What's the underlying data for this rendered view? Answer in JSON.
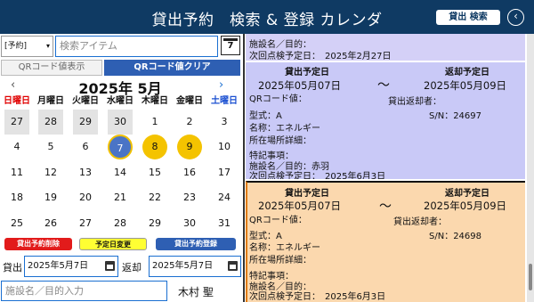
{
  "header": {
    "title": "貸出予約　検索 & 登録 カレンダ",
    "search_button": "貸出 検索",
    "back_icon": "‹"
  },
  "filter": {
    "selected": "[予約]",
    "caret": "▾",
    "search_placeholder": "検索アイテム",
    "calendar_icon_day": "7"
  },
  "qr": {
    "show_label": "QRコード値表示",
    "clear_label": "QRコード値クリア"
  },
  "calendar": {
    "month_title": "2025年 5月",
    "prev": "‹",
    "next": "›",
    "weekdays": [
      "日曜日",
      "月曜日",
      "火曜日",
      "水曜日",
      "木曜日",
      "金曜日",
      "土曜日"
    ],
    "weeks": [
      [
        "27",
        "28",
        "29",
        "30",
        "1",
        "2",
        "3"
      ],
      [
        "4",
        "5",
        "6",
        "7",
        "8",
        "9",
        "10"
      ],
      [
        "11",
        "12",
        "13",
        "14",
        "15",
        "16",
        "17"
      ],
      [
        "18",
        "19",
        "20",
        "21",
        "22",
        "23",
        "24"
      ],
      [
        "25",
        "26",
        "27",
        "28",
        "29",
        "30",
        "31"
      ]
    ],
    "selected_day": "7",
    "highlighted_days": [
      "8",
      "9"
    ]
  },
  "actions": {
    "delete": "貸出予約削除",
    "change": "予定日変更",
    "register": "貸出予約登録"
  },
  "form": {
    "lend_label": "貸出",
    "lend_date": "2025年5月7日",
    "return_label": "返却",
    "return_date": "2025年5月7日",
    "purpose_placeholder": "施設名／目的入力",
    "user": "木村 聖"
  },
  "cards": [
    {
      "facility": "施設名／目的：",
      "next_check": "次回点検予定日：　2025年2月27日"
    },
    {
      "lend_header": "貸出予定日",
      "return_header": "返却予定日",
      "lend_date": "2025年05月07日",
      "tilde": "〜",
      "return_date": "2025年05月09日",
      "qr": "QRコード値：",
      "returner": "貸出返却者：",
      "model": "型式：A",
      "sn": "S/N：24697",
      "name": "名称：エネルギー",
      "location": "所在場所詳細：",
      "notes": "特記事項：",
      "facility": "施設名／目的：赤羽",
      "next_check": "次回点検予定日：　2025年6月3日"
    },
    {
      "lend_header": "貸出予定日",
      "return_header": "返却予定日",
      "lend_date": "2025年05月07日",
      "tilde": "〜",
      "return_date": "2025年05月09日",
      "qr": "QRコード値：",
      "returner": "貸出返却者：",
      "model": "型式：A",
      "sn": "S/N：24698",
      "name": "名称：エネルギー",
      "location": "所在場所詳細：",
      "notes": "特記事項：",
      "facility": "施設名／目的：",
      "next_check": "次回点検予定日：　2025年6月3日"
    }
  ]
}
